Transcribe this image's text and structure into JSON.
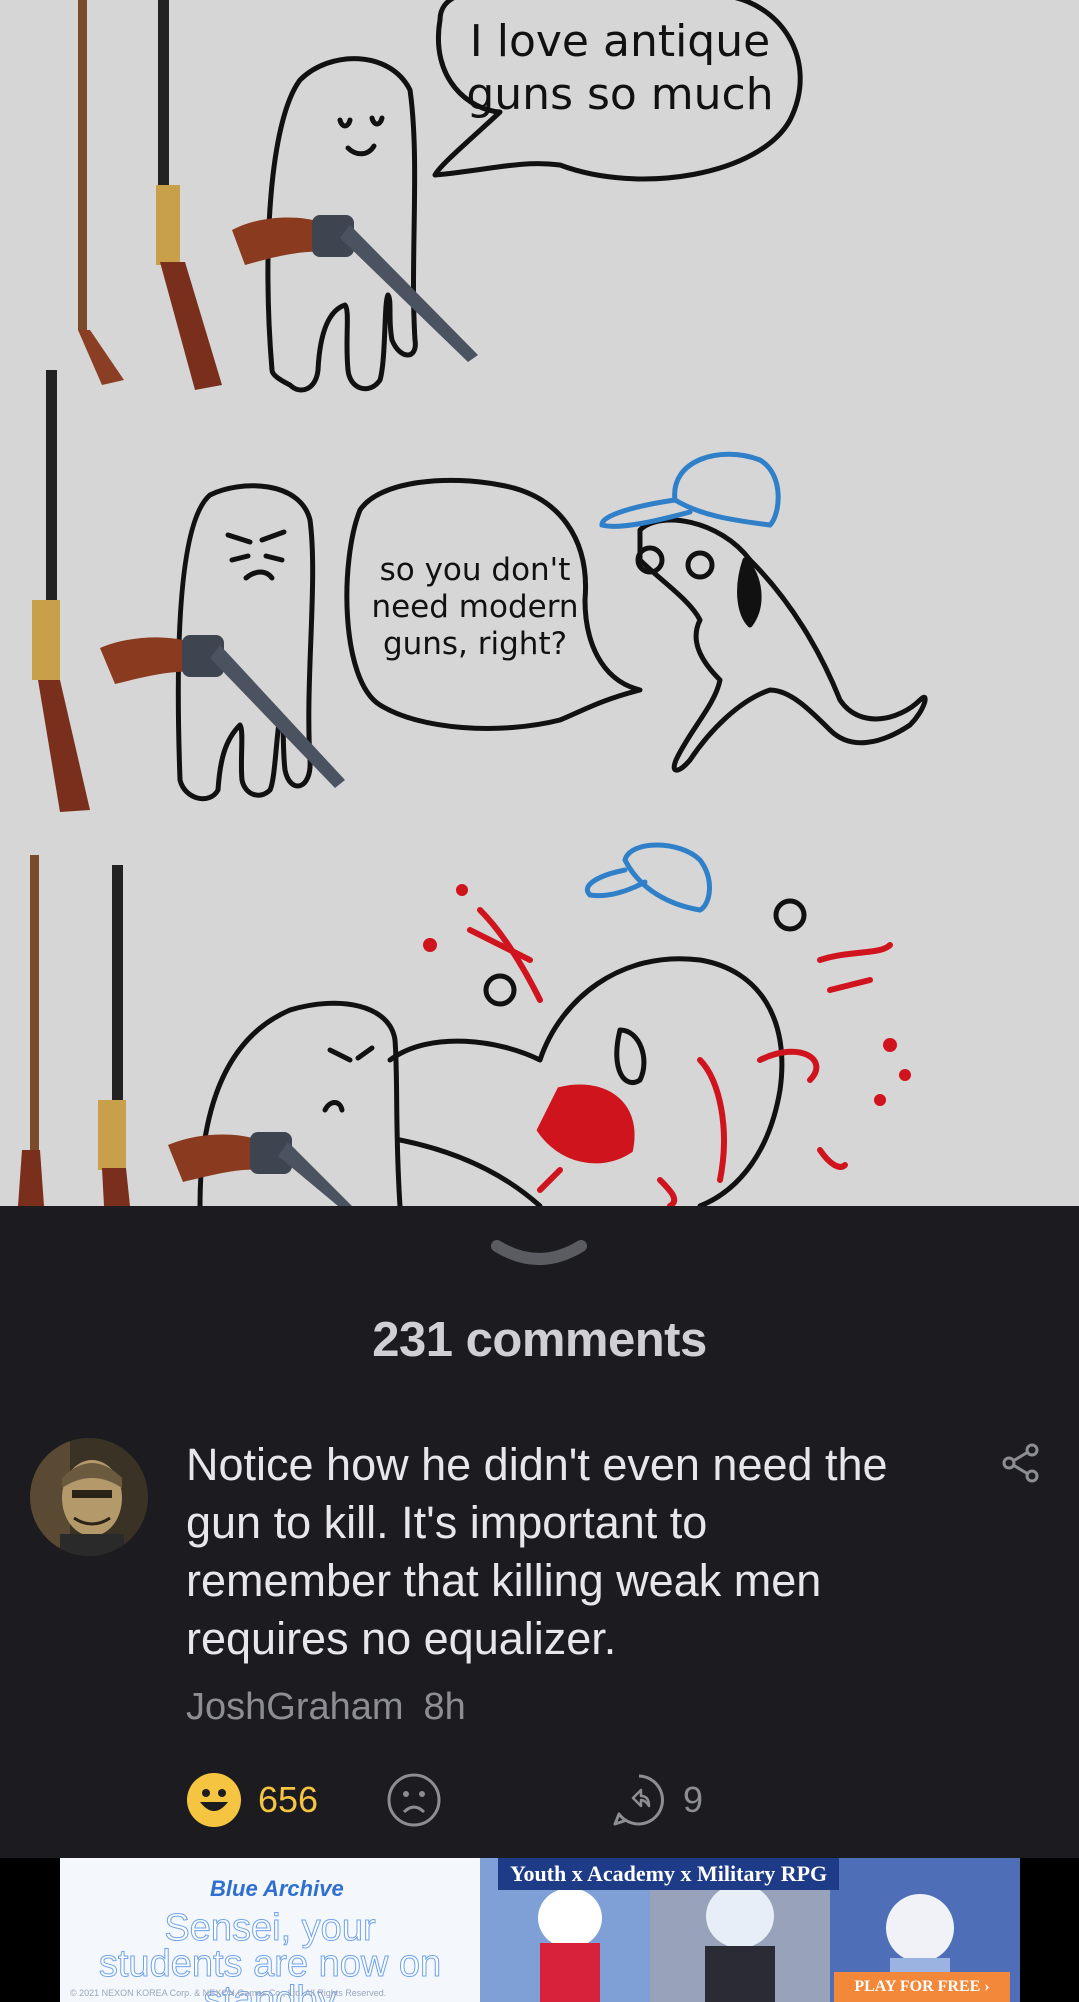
{
  "meme": {
    "panel1_text": "I love antique guns so much",
    "panel2_text": "so you don't need modern guns, right?"
  },
  "comments": {
    "count_label": "231 comments"
  },
  "comment": {
    "text": "Notice how he didn't even need the gun to kill. It's important to remember that killing weak men requires no equalizer.",
    "author": "JoshGraham",
    "time": "8h",
    "upvotes": "656",
    "replies": "9"
  },
  "ad": {
    "brand": "Blue Archive",
    "headline": "Sensei, your students are now on standby",
    "tagline": "Youth x Academy x Military RPG",
    "cta": "PLAY FOR FREE ›",
    "legal": "© 2021 NEXON KOREA Corp. & NEXON Games Co., Ltd. All Rights Reserved."
  },
  "colors": {
    "background": "#1b1b20",
    "upvote": "#f5c542",
    "muted": "#8d8d94"
  }
}
